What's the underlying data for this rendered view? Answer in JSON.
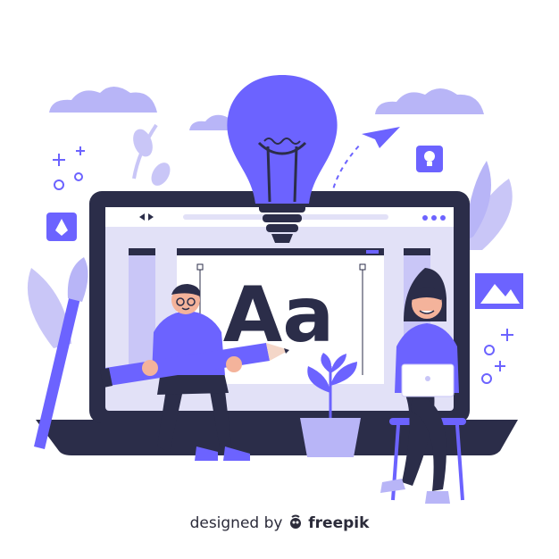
{
  "illustration": {
    "screen_text": "Aa",
    "credit_prefix": "designed by",
    "credit_brand": "freepik",
    "icons": [
      "pen-tool-icon",
      "lightbulb-icon",
      "paper-plane-icon",
      "image-icon",
      "sparkle-icon"
    ],
    "colors": {
      "primary": "#6c63ff",
      "light": "#b8b5f7",
      "pale": "#e2e1f7",
      "dark": "#2b2d49",
      "skin": "#f4b39b"
    }
  }
}
